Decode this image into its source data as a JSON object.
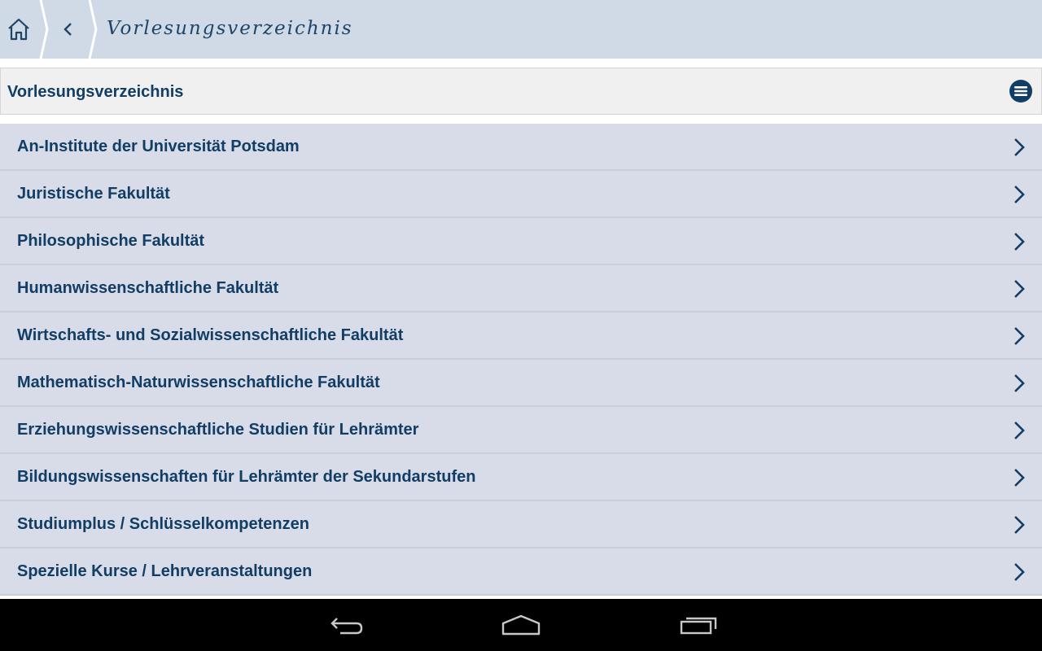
{
  "app_bar": {
    "title": "Vorlesungsverzeichnis",
    "home_icon": "home-icon",
    "back_icon": "chevron-left-icon"
  },
  "section": {
    "title": "Vorlesungsverzeichnis",
    "menu_icon": "menu-icon"
  },
  "list": {
    "items": [
      {
        "label": "An-Institute der Universität Potsdam"
      },
      {
        "label": "Juristische Fakultät"
      },
      {
        "label": "Philosophische Fakultät"
      },
      {
        "label": "Humanwissenschaftliche Fakultät"
      },
      {
        "label": "Wirtschafts- und Sozialwissenschaftliche Fakultät"
      },
      {
        "label": "Mathematisch-Naturwissenschaftliche Fakultät"
      },
      {
        "label": "Erziehungswissenschaftliche Studien für Lehrämter"
      },
      {
        "label": "Bildungswissenschaften für Lehrämter der Sekundarstufen"
      },
      {
        "label": "Studiumplus / Schlüsselkompetenzen"
      },
      {
        "label": "Spezielle Kurse / Lehrveranstaltungen"
      }
    ]
  },
  "system_nav": {
    "back_icon": "system-back-icon",
    "home_icon": "system-home-icon",
    "recents_icon": "system-recents-icon"
  },
  "colors": {
    "app_bar_bg": "#cfdae6",
    "text_primary": "#123d64",
    "list_bg": "#d8dce8",
    "header_bg": "#f0f0f0"
  }
}
